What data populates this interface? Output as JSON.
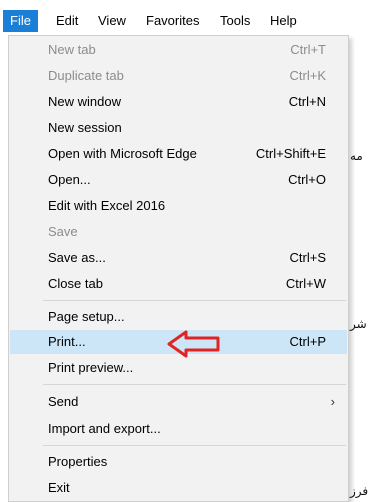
{
  "menubar": {
    "items": [
      {
        "label": "File",
        "active": true
      },
      {
        "label": "Edit"
      },
      {
        "label": "View"
      },
      {
        "label": "Favorites"
      },
      {
        "label": "Tools"
      },
      {
        "label": "Help"
      }
    ]
  },
  "file_menu": {
    "items": [
      {
        "label": "New tab",
        "shortcut": "Ctrl+T",
        "disabled": true
      },
      {
        "label": "Duplicate tab",
        "shortcut": "Ctrl+K",
        "disabled": true
      },
      {
        "label": "New window",
        "shortcut": "Ctrl+N"
      },
      {
        "label": "New session",
        "shortcut": ""
      },
      {
        "label": "Open with Microsoft Edge",
        "shortcut": "Ctrl+Shift+E"
      },
      {
        "label": "Open...",
        "shortcut": "Ctrl+O"
      },
      {
        "label": "Edit with Excel 2016",
        "shortcut": ""
      },
      {
        "label": "Save",
        "shortcut": "",
        "disabled": true
      },
      {
        "label": "Save as...",
        "shortcut": "Ctrl+S"
      },
      {
        "label": "Close tab",
        "shortcut": "Ctrl+W"
      },
      {
        "label": "Page setup...",
        "shortcut": ""
      },
      {
        "label": "Print...",
        "shortcut": "Ctrl+P",
        "highlighted": true
      },
      {
        "label": "Print preview...",
        "shortcut": ""
      },
      {
        "label": "Send",
        "shortcut": "",
        "submenu_arrow": "›"
      },
      {
        "label": "Import and export...",
        "shortcut": ""
      },
      {
        "label": "Properties",
        "shortcut": ""
      },
      {
        "label": "Exit",
        "shortcut": ""
      }
    ]
  },
  "background_text": {
    "fragment_1": "مه",
    "fragment_2": "شر",
    "fragment_3": "فرز"
  },
  "annotation": {
    "icon": "red-arrow-left-icon",
    "color": "#e02424"
  },
  "colors": {
    "active_menu": "#1a7fd6",
    "highlight": "#cde6f7",
    "menu_bg": "#f2f2f2",
    "disabled_text": "#8c8c8c"
  }
}
